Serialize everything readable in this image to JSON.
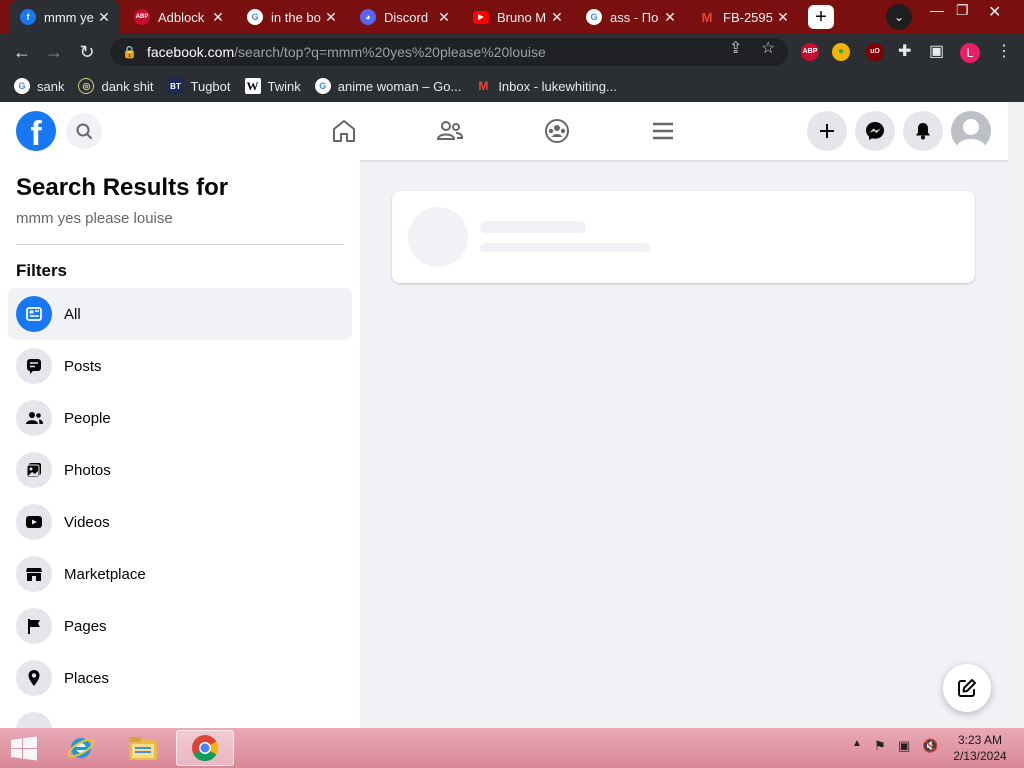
{
  "browser": {
    "tabs": [
      {
        "title": "mmm ye",
        "icon": "facebook-icon",
        "color": "#1877f2",
        "active": true
      },
      {
        "title": "Adblock",
        "icon": "abp-icon",
        "color": "#c70d2c"
      },
      {
        "title": "in the bo",
        "icon": "google-icon",
        "color": "#ffffff"
      },
      {
        "title": "Discord",
        "icon": "discord-icon",
        "color": "#5865f2"
      },
      {
        "title": "Bruno M",
        "icon": "youtube-icon",
        "color": "#ff0000"
      },
      {
        "title": "ass - По",
        "icon": "google-icon",
        "color": "#ffffff"
      },
      {
        "title": "FB-2595",
        "icon": "gmail-icon",
        "color": "#ffffff"
      }
    ],
    "url_host": "facebook.com",
    "url_path": "/search/top?q=mmm%20yes%20please%20louise",
    "profile_initial": "L",
    "bookmarks": [
      {
        "label": "sank",
        "icon": "google-icon"
      },
      {
        "label": "dank shit",
        "icon": "globe-icon"
      },
      {
        "label": "Tugbot",
        "icon": "bt-icon"
      },
      {
        "label": "Twink",
        "icon": "wikipedia-icon"
      },
      {
        "label": "anime woman – Go...",
        "icon": "google-icon"
      },
      {
        "label": "Inbox - lukewhiting...",
        "icon": "gmail-icon"
      }
    ]
  },
  "search": {
    "title": "Search Results for",
    "query": "mmm yes please louise",
    "filters_label": "Filters",
    "filters": [
      {
        "label": "All",
        "icon": "feed-icon",
        "active": true
      },
      {
        "label": "Posts",
        "icon": "posts-icon"
      },
      {
        "label": "People",
        "icon": "people-icon"
      },
      {
        "label": "Photos",
        "icon": "photos-icon"
      },
      {
        "label": "Videos",
        "icon": "videos-icon"
      },
      {
        "label": "Marketplace",
        "icon": "marketplace-icon"
      },
      {
        "label": "Pages",
        "icon": "flag-icon"
      },
      {
        "label": "Places",
        "icon": "pin-icon"
      }
    ]
  },
  "taskbar": {
    "time": "3:23 AM",
    "date": "2/13/2024"
  },
  "colors": {
    "fb_blue": "#1877f2",
    "tab_bar": "#7a0f0f",
    "chrome_dark": "#2b2f33"
  }
}
